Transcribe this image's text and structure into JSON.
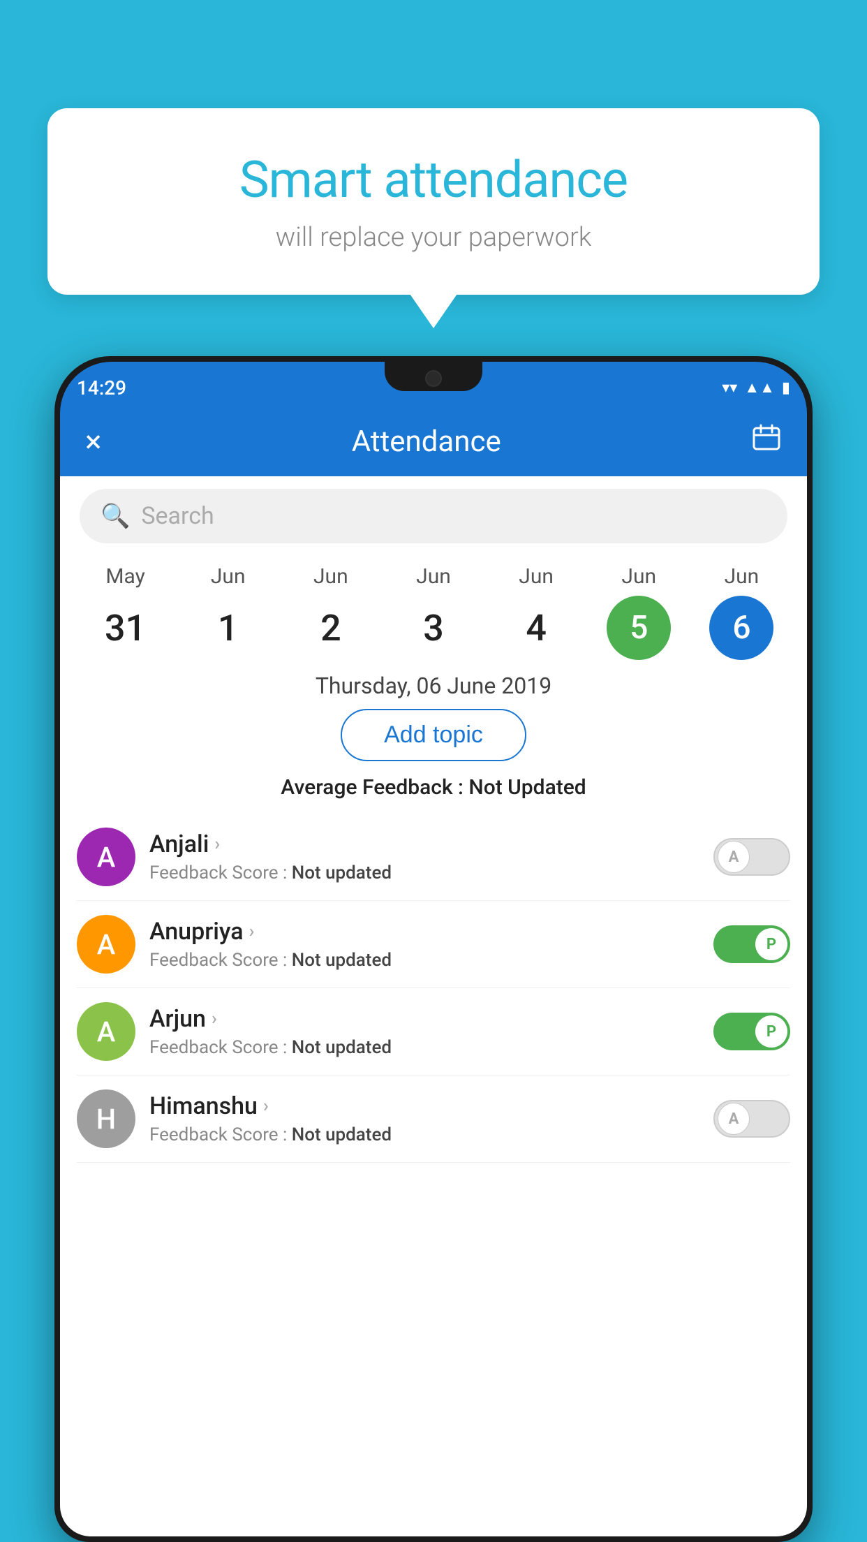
{
  "background_color": "#29b6d8",
  "speech_bubble": {
    "title": "Smart attendance",
    "subtitle": "will replace your paperwork"
  },
  "status_bar": {
    "time": "14:29",
    "wifi": "▼",
    "signal": "▲",
    "battery": "▮"
  },
  "app_bar": {
    "title": "Attendance",
    "close_label": "×",
    "calendar_label": "📅"
  },
  "search": {
    "placeholder": "Search"
  },
  "dates": [
    {
      "month": "May",
      "day": "31",
      "state": "normal"
    },
    {
      "month": "Jun",
      "day": "1",
      "state": "normal"
    },
    {
      "month": "Jun",
      "day": "2",
      "state": "normal"
    },
    {
      "month": "Jun",
      "day": "3",
      "state": "normal"
    },
    {
      "month": "Jun",
      "day": "4",
      "state": "normal"
    },
    {
      "month": "Jun",
      "day": "5",
      "state": "today"
    },
    {
      "month": "Jun",
      "day": "6",
      "state": "selected"
    }
  ],
  "selected_date": "Thursday, 06 June 2019",
  "add_topic_label": "Add topic",
  "avg_feedback_label": "Average Feedback :",
  "avg_feedback_value": "Not Updated",
  "students": [
    {
      "name": "Anjali",
      "avatar_letter": "A",
      "avatar_color": "#9c27b0",
      "feedback_label": "Feedback Score :",
      "feedback_value": "Not updated",
      "toggle_state": "off",
      "toggle_letter": "A"
    },
    {
      "name": "Anupriya",
      "avatar_letter": "A",
      "avatar_color": "#ff9800",
      "feedback_label": "Feedback Score :",
      "feedback_value": "Not updated",
      "toggle_state": "on",
      "toggle_letter": "P"
    },
    {
      "name": "Arjun",
      "avatar_letter": "A",
      "avatar_color": "#8bc34a",
      "feedback_label": "Feedback Score :",
      "feedback_value": "Not updated",
      "toggle_state": "on",
      "toggle_letter": "P"
    },
    {
      "name": "Himanshu",
      "avatar_letter": "H",
      "avatar_color": "#9e9e9e",
      "feedback_label": "Feedback Score :",
      "feedback_value": "Not updated",
      "toggle_state": "off",
      "toggle_letter": "A"
    }
  ]
}
